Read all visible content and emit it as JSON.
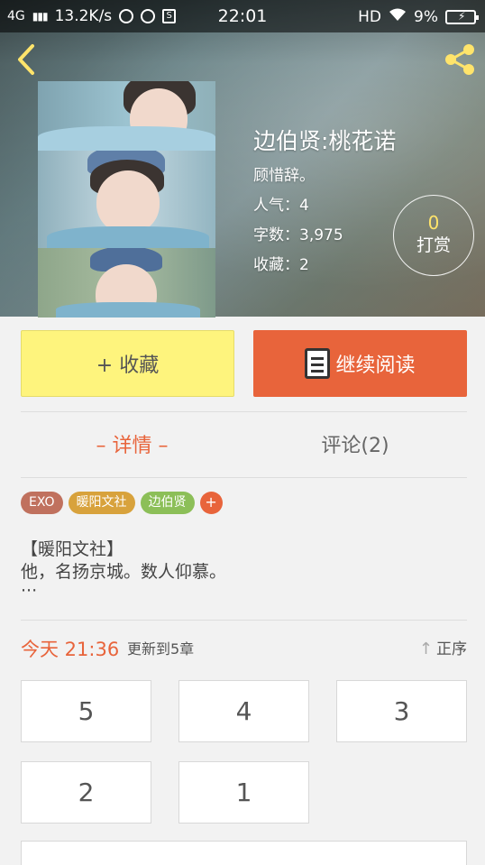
{
  "status_bar": {
    "network": "4G",
    "speed": "13.2K/s",
    "time": "22:01",
    "hd": "HD",
    "battery": "9%"
  },
  "book": {
    "title": "边伯贤:桃花诺",
    "author": "顾惜辞。",
    "popularity": "人气：4",
    "word_count": "字数：3,975",
    "favorites": "收藏：2"
  },
  "tip": {
    "count": "0",
    "label": "打赏"
  },
  "actions": {
    "favorite_label": "+ 收藏",
    "read_label": "继续阅读"
  },
  "tabs": {
    "detail": "– 详情 –",
    "comments": "评论(2)"
  },
  "tags": [
    {
      "label": "EXO",
      "color": "#c0715e"
    },
    {
      "label": "暖阳文社",
      "color": "#d8a23c"
    },
    {
      "label": "边伯贤",
      "color": "#8cbf58"
    }
  ],
  "tag_add": "+",
  "description": [
    "【暖阳文社】",
    "他，名扬京城。数人仰慕。",
    "···"
  ],
  "update": {
    "date": "今天 21:36",
    "text": "更新到5章",
    "sort_label": "正序",
    "sort_icon": "up-arrow-icon"
  },
  "chapters": [
    "5",
    "4",
    "3",
    "2",
    "1"
  ],
  "colors": {
    "accent": "#e8643b",
    "favorite_bg": "#fef47d"
  }
}
